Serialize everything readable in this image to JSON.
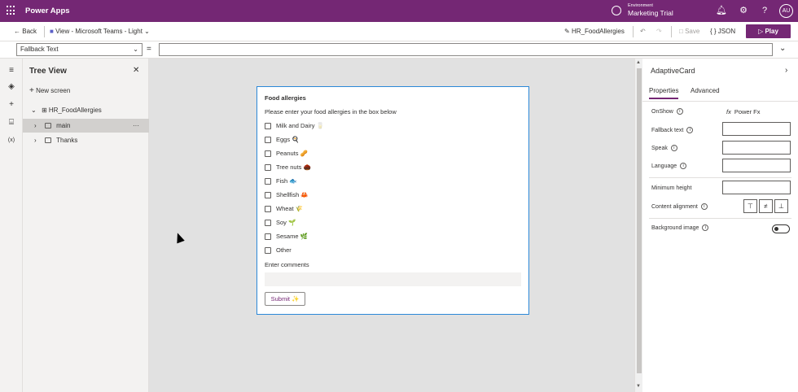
{
  "topbar": {
    "brand": "Power Apps",
    "environment_label": "Environment",
    "environment_name": "Marketing Trial",
    "avatar": "AU",
    "icons": [
      "waffle-icon",
      "environment-icon",
      "bell-icon",
      "gear-icon",
      "help-icon"
    ]
  },
  "commandbar": {
    "back": "Back",
    "view": "View - Microsoft Teams - Light",
    "app_name": "HR_FoodAllergies",
    "save": "Save",
    "json": "{ } JSON",
    "play": "Play"
  },
  "formulabar": {
    "property": "Fallback Text",
    "equals": "=",
    "formula": ""
  },
  "tree": {
    "title": "Tree View",
    "new_screen": "New screen",
    "app": "HR_FoodAllergies",
    "screens": [
      "main",
      "Thanks"
    ],
    "more": "···"
  },
  "card": {
    "title": "Food allergies",
    "prompt": "Please enter your food allergies in the box below",
    "options": [
      "Milk and Dairy 🥛",
      "Eggs 🍳",
      "Peanuts 🥜",
      "Tree nuts 🌰",
      "Fish 🐟",
      "Shellfish 🦀",
      "Wheat 🌾",
      "Soy 🌱",
      "Sesame 🌿",
      "Other"
    ],
    "comments_label": "Enter comments",
    "submit": "Submit ✨"
  },
  "properties": {
    "title": "AdaptiveCard",
    "tabs": [
      "Properties",
      "Advanced"
    ],
    "active_tab": "Properties",
    "onshow_label": "OnShow",
    "onshow_value": "Power Fx",
    "fx": "fx",
    "fallback_label": "Fallback text",
    "speak_label": "Speak",
    "language_label": "Language",
    "min_height_label": "Minimum height",
    "content_alignment_label": "Content alignment",
    "background_image_label": "Background image",
    "info": "i"
  },
  "colors": {
    "brand": "#742774",
    "selection": "#2b88d8"
  }
}
